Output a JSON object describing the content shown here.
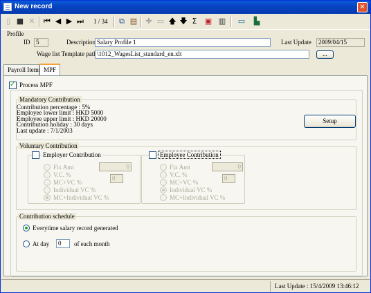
{
  "window": {
    "title": "New record",
    "close_glyph": "✕"
  },
  "toolbar": {
    "page_indicator": "1 / 34",
    "buttons": [
      "new-icon",
      "save-icon",
      "delete-icon",
      "first-icon",
      "prev-icon",
      "next-icon",
      "last-icon",
      "copy-icon",
      "paste-icon",
      "add-row-icon",
      "remove-row-icon",
      "up-icon",
      "down-icon",
      "sum-icon",
      "print-icon",
      "export-icon",
      "screen-icon",
      "exit-icon"
    ]
  },
  "profile": {
    "section_label": "Profile",
    "id_label": "ID",
    "id_value": "5",
    "description_label": "Description",
    "description_value": "Salary Profile 1",
    "last_update_label": "Last Update",
    "last_update_value": "2009/04/15",
    "template_label": "Wage list Template path",
    "template_value": "\\1012_WagesList_standard_en.xlt",
    "browse_label": "..."
  },
  "tabs": [
    {
      "label": "Payroll Items",
      "active": false
    },
    {
      "label": "MPF",
      "active": true
    }
  ],
  "mpf": {
    "process_label": "Process MPF",
    "mandatory": {
      "title": "Mandatory Contribution",
      "lines": [
        "Contribution percentage : 5%",
        "Employee lower limit : HKD 5000",
        "Employee upper limit : HKD 20000",
        "Contribution holiday : 30 days",
        "Last update : 7/1/2003"
      ],
      "setup_label": "Setup"
    },
    "voluntary": {
      "title": "Voluntary Contribution",
      "employer": {
        "title": "Employer Contribution",
        "options": [
          "Fix Amt",
          "V.C. %",
          "MC+VC %",
          "Individual VC %",
          "MC+Individual VC %"
        ],
        "amount_value": "0",
        "pct_value": "0"
      },
      "employee": {
        "title": "Employee Contribution",
        "options": [
          "Fix Amt",
          "V.C. %",
          "MC+VC %",
          "Individual VC %",
          "MC+Individual VC %"
        ],
        "amount_value": "0",
        "pct_value": "0"
      }
    },
    "schedule": {
      "title": "Contribution schedule",
      "option1": "Everytime salary record generated",
      "option2_prefix": "At day",
      "day_value": "0",
      "option2_suffix": "of each month"
    }
  },
  "status": {
    "last_update": "Last Update : 15/4/2009 13:46:12"
  }
}
